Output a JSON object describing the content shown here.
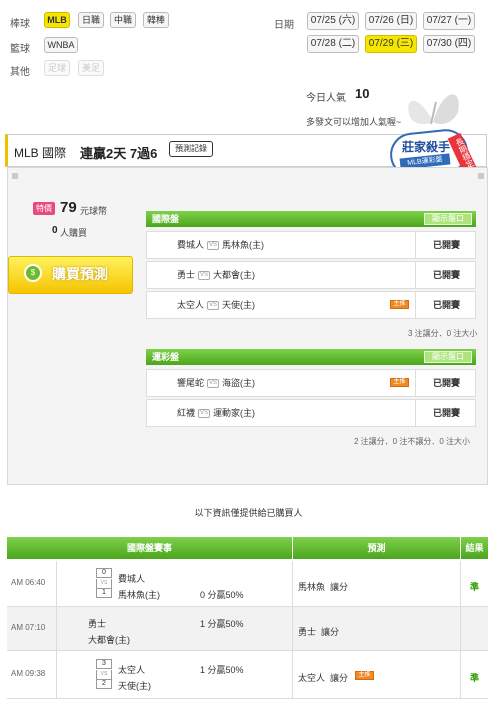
{
  "sports": {
    "rows": [
      {
        "label": "棒球",
        "items": [
          {
            "text": "MLB",
            "state": "selected"
          },
          {
            "text": "日職",
            "state": "normal"
          },
          {
            "text": "中職",
            "state": "normal"
          },
          {
            "text": "韓棒",
            "state": "normal"
          }
        ]
      },
      {
        "label": "籃球",
        "items": [
          {
            "text": "WNBA",
            "state": "normal"
          }
        ]
      },
      {
        "label": "其他",
        "items": [
          {
            "text": "足球",
            "state": "disabled"
          },
          {
            "text": "美足",
            "state": "disabled"
          }
        ]
      }
    ]
  },
  "dates": {
    "label": "日期",
    "items": [
      {
        "text": "07/25 (六)",
        "state": "normal"
      },
      {
        "text": "07/26 (日)",
        "state": "normal"
      },
      {
        "text": "07/27 (一)",
        "state": "normal"
      },
      {
        "text": "07/28 (二)",
        "state": "normal"
      },
      {
        "text": "07/29 (三)",
        "state": "selected"
      },
      {
        "text": "07/30 (四)",
        "state": "normal"
      }
    ]
  },
  "popularity": {
    "label": "今日人氣",
    "value": "10",
    "hint": "多發文可以增加人氣喔~"
  },
  "banner": {
    "line1": "莊家殺手",
    "line2": "MLB運彩盤",
    "ribbon": "長期穩定"
  },
  "predictor": {
    "league": "MLB 國際",
    "streak": "連贏2天 7過6",
    "record_button": "預測記錄"
  },
  "purchase": {
    "special_tag": "特價",
    "price": "79",
    "price_unit": "元球幣",
    "buyers": "0",
    "buyers_label": "人購買",
    "buy_button": "購買預測",
    "buy_icon": "coin-icon"
  },
  "intl": {
    "title": "國際盤",
    "show_button": "顯示盤口",
    "games": [
      {
        "away": "費城人",
        "home": "馬林魚(主)",
        "star": false,
        "status": "已開賽"
      },
      {
        "away": "勇士",
        "home": "大都會(主)",
        "star": false,
        "status": "已開賽"
      },
      {
        "away": "太空人",
        "home": "天使(主)",
        "star": true,
        "status": "已開賽"
      }
    ],
    "summary": "3 注讓分．0 注大小"
  },
  "lottery": {
    "title": "運彩盤",
    "show_button": "顯示盤口",
    "games": [
      {
        "away": "響尾蛇",
        "home": "海盜(主)",
        "star": true,
        "status": "已開賽"
      },
      {
        "away": "紅襪",
        "home": "運動家(主)",
        "star": false,
        "status": "已開賽"
      }
    ],
    "summary": "2 注讓分．0 注不讓分．0 注大小"
  },
  "vs_label": "VS",
  "star_label": "主推",
  "notice": "以下資訊僅提供給已購買人",
  "results": {
    "headers": [
      "國際盤賽事",
      "預測",
      "結果"
    ],
    "rows": [
      {
        "time": "AM 06:40",
        "away": "費城人",
        "home": "馬林魚(主)",
        "away_score": "0",
        "home_score": "1",
        "line": "0 分贏50%",
        "pick_team": "馬林魚",
        "pick_type": "讓分",
        "star": false,
        "result": "準"
      },
      {
        "time": "AM 07:10",
        "away": "勇士",
        "home": "大都會(主)",
        "away_score": "",
        "home_score": "",
        "line": "1 分贏50%",
        "pick_team": "勇士",
        "pick_type": "讓分",
        "star": false,
        "result": ""
      },
      {
        "time": "AM 09:38",
        "away": "太空人",
        "home": "天使(主)",
        "away_score": "3",
        "home_score": "2",
        "line": "1 分贏50%",
        "pick_team": "太空人",
        "pick_type": "讓分",
        "star": true,
        "result": "準"
      }
    ]
  },
  "colors": {
    "accent": "#f5e600",
    "green": "#4aa61d",
    "result": "#2e9a00",
    "star": "#f08a24"
  }
}
